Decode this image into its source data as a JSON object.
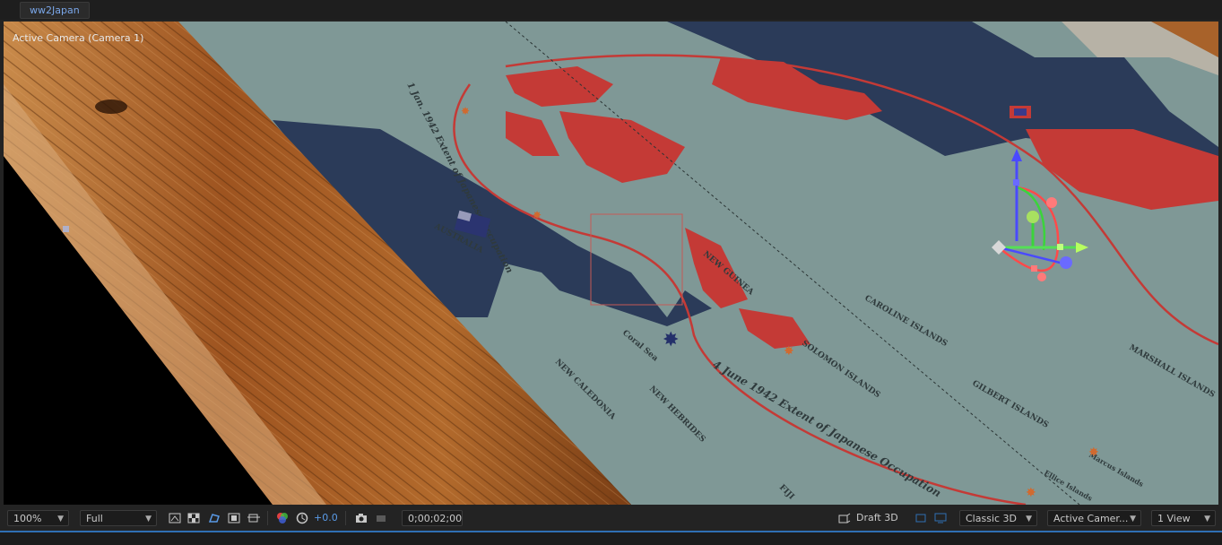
{
  "composition_tab": {
    "label": "ww2Japan"
  },
  "viewer": {
    "camera_label": "Active Camera (Camera 1)",
    "map_labels": {
      "australia": "AUSTRALIA",
      "new_guinea": "NEW GUINEA",
      "coral_sea": "Coral Sea",
      "new_caledonia": "NEW CALEDONIA",
      "new_hebrides": "NEW HEBRIDES",
      "solomon_islands": "SOLOMON ISLANDS",
      "caroline_islands": "CAROLINE ISLANDS",
      "gilbert_islands": "GILBERT ISLANDS",
      "marshall_islands": "MARSHALL ISLANDS",
      "marcus_islands": "Marcus Islands",
      "ellice_islands": "Ellice Islands",
      "fiji": "FIJI",
      "occupation_1942": "4 June 1942 Extent of Japanese Occupation",
      "occupation_1941": "1 Jan. 1942 Extent of Japanese Occupation"
    }
  },
  "toolbar": {
    "zoom": "100%",
    "resolution": "Full",
    "exposure": "+0.0",
    "timecode": "0;00;02;00",
    "renderer_mode": "Draft 3D",
    "renderer": "Classic 3D",
    "view_camera": "Active Camer...",
    "view_layout": "1 View"
  },
  "colors": {
    "ocean": "#7f9896",
    "land_blue": "#2b3b59",
    "occupied_red": "#c43a36",
    "wood": "#a05a22",
    "accent_blue": "#5a9be8"
  }
}
